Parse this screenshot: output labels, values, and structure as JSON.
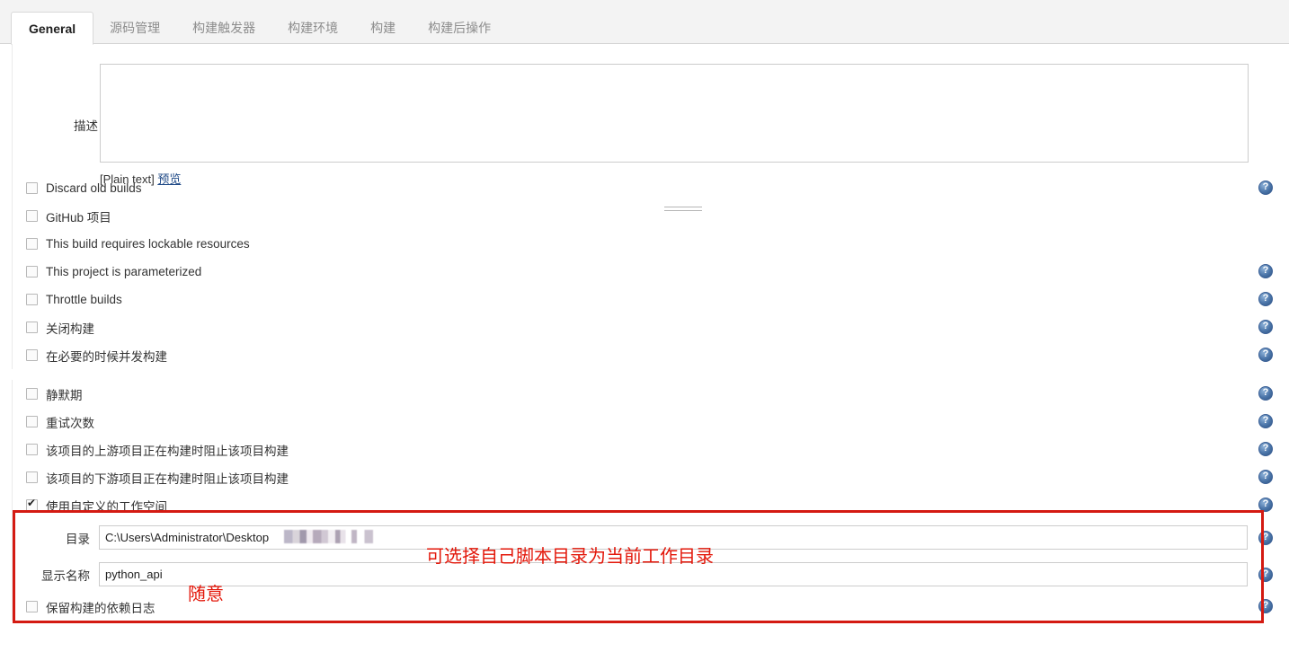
{
  "tabs": [
    {
      "label": "General",
      "active": true
    },
    {
      "label": "源码管理",
      "active": false
    },
    {
      "label": "构建触发器",
      "active": false
    },
    {
      "label": "构建环境",
      "active": false
    },
    {
      "label": "构建",
      "active": false
    },
    {
      "label": "构建后操作",
      "active": false
    }
  ],
  "description": {
    "label": "描述",
    "value": "",
    "format_note": "[Plain text]",
    "preview_link": "预览"
  },
  "checkboxes": [
    {
      "label": "Discard old builds",
      "checked": false,
      "help": true
    },
    {
      "label": "GitHub 项目",
      "checked": false,
      "help": false
    },
    {
      "label": "This build requires lockable resources",
      "checked": false,
      "help": false
    },
    {
      "label": "This project is parameterized",
      "checked": false,
      "help": true
    },
    {
      "label": "Throttle builds",
      "checked": false,
      "help": true
    },
    {
      "label": "关闭构建",
      "checked": false,
      "help": true
    },
    {
      "label": "在必要的时候并发构建",
      "checked": false,
      "help": true
    }
  ],
  "checkboxes2": [
    {
      "label": "静默期",
      "checked": false,
      "help": true
    },
    {
      "label": "重试次数",
      "checked": false,
      "help": true
    },
    {
      "label": "该项目的上游项目正在构建时阻止该项目构建",
      "checked": false,
      "help": true
    },
    {
      "label": "该项目的下游项目正在构建时阻止该项目构建",
      "checked": false,
      "help": true
    }
  ],
  "workspace": {
    "checkbox_label": "使用自定义的工作空间",
    "checked": true,
    "help": true,
    "directory": {
      "label": "目录",
      "value": "C:\\Users\\Administrator\\Desktop",
      "redacted": true,
      "help": true
    },
    "display_name": {
      "label": "显示名称",
      "value": "python_api",
      "help": true
    }
  },
  "checkboxes3": [
    {
      "label": "保留构建的依赖日志",
      "checked": false,
      "help": true
    }
  ],
  "annotations": [
    {
      "id": "annot-dir",
      "text": "可选择自己脚本目录为当前工作目录",
      "color": "#e3170a"
    },
    {
      "id": "annot-name",
      "text": "随意",
      "color": "#e3170a"
    }
  ],
  "colors": {
    "annotation_red": "#e3170a",
    "highlight_box": "#d41a12",
    "help_icon_blue": "#3b6096",
    "link_blue": "#204a87"
  }
}
